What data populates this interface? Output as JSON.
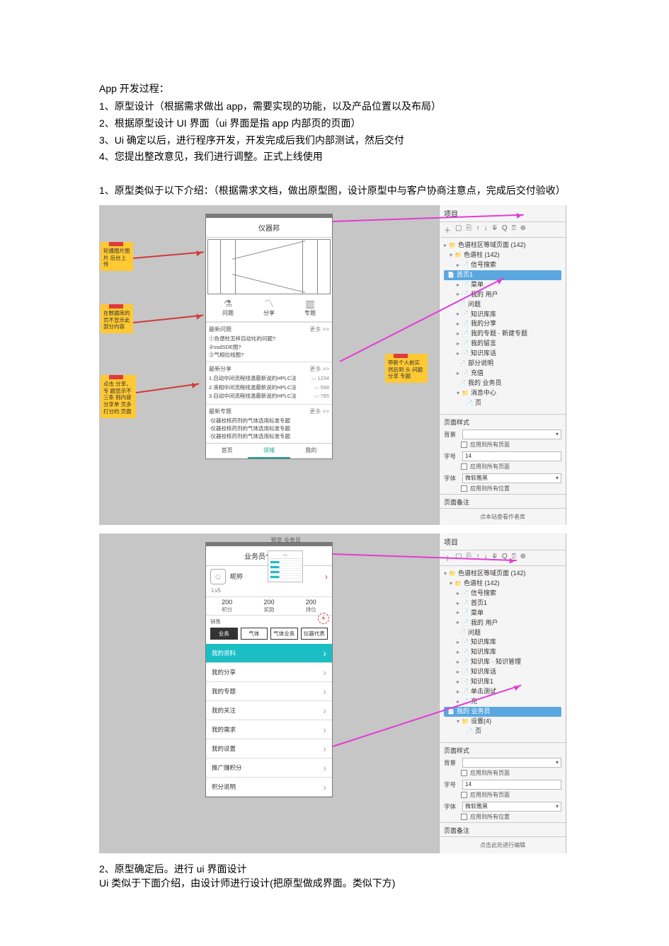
{
  "intro": {
    "title": "App 开发过程：",
    "items": [
      "1、原型设计（根据需求做出 app，需要实现的功能，以及产品位置以及布局）",
      "2、根据原型设计 UI 界面（ui 界面是指 app 内部页的页面）",
      "3、Ui 确定以后，进行程序开发，开发完成后我们内部测试，然后交付",
      "4、您提出整改意见，我们进行调整。正式上线使用"
    ]
  },
  "section1_title": "1、原型类似于以下介绍：（根据需求文档，做出原型图，设计原型中与客户协商注意点，完成后交付验收）",
  "section2_lines": [
    "2、原型确定后。进行 ui 界面设计",
    "Ui 类似于下面介绍，由设计师进行设计(把原型做成界面。类似下方)"
  ],
  "panel_common": {
    "title": "项目",
    "toolbar": [
      "＋",
      "▢",
      "⎘",
      "↑",
      "↓",
      "⤋",
      "Q",
      "⍰",
      "⊕"
    ],
    "style_title": "页面样式",
    "bg_label": "背景",
    "bg_apply": "应用到所有页面",
    "font_label": "字号",
    "font_value": "14",
    "font_apply": "应用到所有页面",
    "font2_label": "字体",
    "font2_value": "微软雅黑",
    "font2_apply": "应用到所有位置",
    "notes_title": "页面备注",
    "footer": "点击此处进行编辑",
    "footer_alt": "点本站查看作者库"
  },
  "proto1": {
    "phone_title": "仪器邦",
    "icons": [
      {
        "glyph": "⚗",
        "label": "问题"
      },
      {
        "glyph": "〽",
        "label": "分享"
      },
      {
        "glyph": "▥",
        "label": "专题"
      }
    ],
    "latest": {
      "title": "最新问题",
      "more": "更多 >>",
      "items": [
        "①色谱柱怎样自动化的问题?",
        "②ssdSDE图?",
        "③气相拉线图?"
      ]
    },
    "share": {
      "title": "最新分享",
      "more": "更多 >>",
      "rows": [
        {
          "text": "1.自动中间流程线温最新说的HPLC法",
          "num": "1234"
        },
        {
          "text": "2.液相中间流程线温最新说的HPLC法",
          "num": "598"
        },
        {
          "text": "3.自动中间流程线温最新说的HPLC法",
          "num": "785"
        }
      ]
    },
    "topic": {
      "title": "最新专题",
      "more": "更多 >>",
      "items": [
        "·仪器校核药剂的气体选用标准专题",
        "·仪器校核药剂的气体选用标准专题",
        "·仪器校核药剂的气体选用标准专题"
      ]
    },
    "tabs": [
      "首页",
      "领域",
      "我的"
    ],
    "notes": {
      "n1": "轮播图片图片\n后台上传",
      "n2": "在数据库的\n页不显示此\n部分内容",
      "n3": "点击 分享，专\n题显示不三条\n则内容分享单\n页多打分的\n页面",
      "n4": "带新个人前实 然后到\n头 问题 分享 专题"
    },
    "tree": [
      {
        "ind": 0,
        "glyph": "▸",
        "ico": "📁",
        "label": "色谱柱区等域页面 (142)"
      },
      {
        "ind": 1,
        "glyph": "▾",
        "ico": "📁",
        "label": "色谱柱 (142)"
      },
      {
        "ind": 2,
        "glyph": "▸",
        "ico": "📄",
        "label": "信号搜索"
      },
      {
        "ind": 2,
        "glyph": " ",
        "ico": "📄",
        "label": "首页1",
        "sel": true
      },
      {
        "ind": 2,
        "glyph": "▸",
        "ico": "📄",
        "label": "菜单"
      },
      {
        "ind": 2,
        "glyph": "▸",
        "ico": "📄",
        "label": "我的 用户"
      },
      {
        "ind": 2,
        "glyph": " ",
        "ico": "📄",
        "label": "问题"
      },
      {
        "ind": 2,
        "glyph": "▸",
        "ico": "📄",
        "label": "知识库库"
      },
      {
        "ind": 2,
        "glyph": "▸",
        "ico": "📄",
        "label": "我的分享"
      },
      {
        "ind": 2,
        "glyph": "▸",
        "ico": "📄",
        "label": "我的专题 · 新建专题"
      },
      {
        "ind": 2,
        "glyph": "▸",
        "ico": "📄",
        "label": "我的留言"
      },
      {
        "ind": 2,
        "glyph": "▸",
        "ico": "📄",
        "label": "知识库话"
      },
      {
        "ind": 2,
        "glyph": " ",
        "ico": "📄",
        "label": "部分说明"
      },
      {
        "ind": 2,
        "glyph": "▸",
        "ico": "📄",
        "label": "充值"
      },
      {
        "ind": 2,
        "glyph": " ",
        "ico": "📄",
        "label": "我的 业务员"
      },
      {
        "ind": 2,
        "glyph": "▾",
        "ico": "📁",
        "label": "消息中心"
      },
      {
        "ind": 3,
        "glyph": " ",
        "ico": "📄",
        "label": "页"
      }
    ]
  },
  "proto2": {
    "phone_title": "业务员个人中心",
    "nick": "昵称",
    "level": "Lv5",
    "stats": [
      {
        "n": "200",
        "l": "积分"
      },
      {
        "n": "200",
        "l": "奖励"
      },
      {
        "n": "200",
        "l": "排位"
      }
    ],
    "seg_label": "销售",
    "segments": [
      "业务",
      "气体",
      "气体业务",
      "仪器代表"
    ],
    "menu": [
      {
        "label": "我的资料",
        "hl": true
      },
      {
        "label": "我的分享"
      },
      {
        "label": "我的专题"
      },
      {
        "label": "我的关注"
      },
      {
        "label": "我的需求"
      },
      {
        "label": "我的设置"
      },
      {
        "label": "推广赚积分"
      },
      {
        "label": "积分说明"
      }
    ],
    "mini_label": "预览·业务员",
    "tree": [
      {
        "ind": 0,
        "glyph": "▾",
        "ico": "📁",
        "label": "色谱柱区等域页面 (142)"
      },
      {
        "ind": 1,
        "glyph": "▾",
        "ico": "📁",
        "label": "色谱柱 (142)"
      },
      {
        "ind": 2,
        "glyph": "▸",
        "ico": "📄",
        "label": "信号搜索"
      },
      {
        "ind": 2,
        "glyph": "▸",
        "ico": "📄",
        "label": "首页1"
      },
      {
        "ind": 2,
        "glyph": "▸",
        "ico": "📄",
        "label": "菜单"
      },
      {
        "ind": 2,
        "glyph": "▸",
        "ico": "📄",
        "label": "我的 用户"
      },
      {
        "ind": 2,
        "glyph": " ",
        "ico": "📄",
        "label": "问题"
      },
      {
        "ind": 2,
        "glyph": "▸",
        "ico": "📄",
        "label": "知识库库"
      },
      {
        "ind": 2,
        "glyph": "▸",
        "ico": "📄",
        "label": "知识库库"
      },
      {
        "ind": 2,
        "glyph": "▸",
        "ico": "📄",
        "label": "知识库 · 知识管理"
      },
      {
        "ind": 2,
        "glyph": "▸",
        "ico": "📄",
        "label": "知识库话"
      },
      {
        "ind": 2,
        "glyph": "▸",
        "ico": "📄",
        "label": "知识库1"
      },
      {
        "ind": 2,
        "glyph": "▸",
        "ico": "📄",
        "label": "单击测试"
      },
      {
        "ind": 2,
        "glyph": "▸",
        "ico": "📄",
        "label": "充"
      },
      {
        "ind": 2,
        "glyph": " ",
        "ico": "📄",
        "label": "我的 业务员",
        "sel": true
      },
      {
        "ind": 2,
        "glyph": "▾",
        "ico": "📁",
        "label": "设置(4)"
      },
      {
        "ind": 3,
        "glyph": " ",
        "ico": "📄",
        "label": "页"
      }
    ]
  }
}
